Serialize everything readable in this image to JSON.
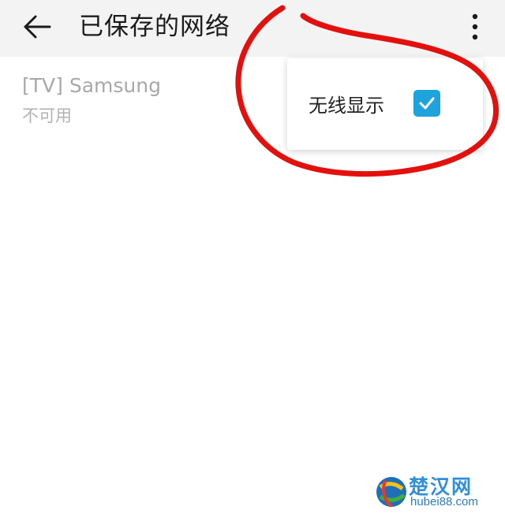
{
  "header": {
    "title": "已保存的网络",
    "back_icon": "arrow-left-icon",
    "more_icon": "more-vertical-icon"
  },
  "networks": [
    {
      "name": "[TV] Samsung",
      "status": "不可用"
    }
  ],
  "popup_menu": {
    "items": [
      {
        "label": "无线显示",
        "checked": true
      }
    ]
  },
  "watermark": {
    "title": "楚汉网",
    "url": "hubei88.com"
  },
  "colors": {
    "topbar_bg": "#f3f3f3",
    "checkbox_accent": "#1fa3dc",
    "annotation_red": "#e3100e",
    "watermark_blue": "#2f8fd8"
  }
}
